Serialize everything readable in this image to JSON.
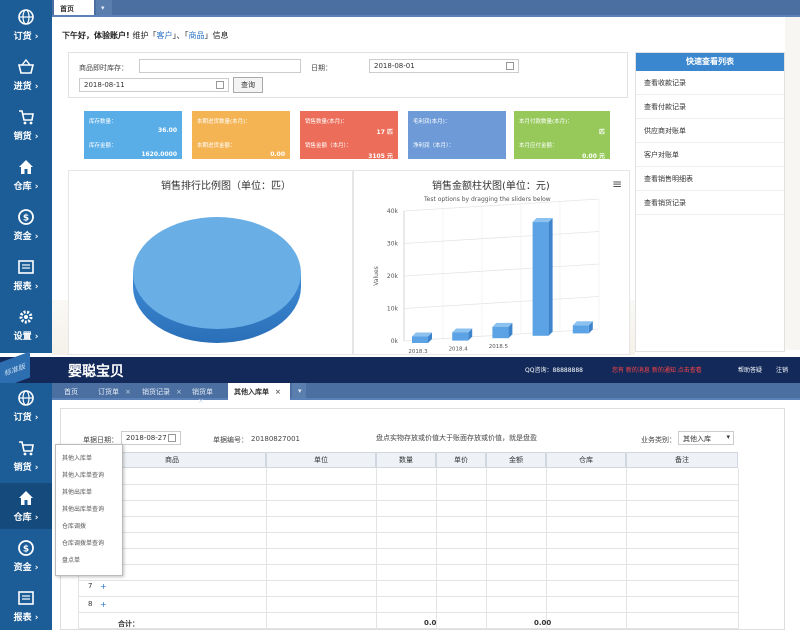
{
  "top": {
    "tabs": [
      {
        "label": "首页"
      }
    ],
    "greeting": {
      "text": "下午好，体验账户!",
      "prefix": "维护「",
      "link1": "客户",
      "sep": "」、「",
      "link2": "商品",
      "suffix": "」信息"
    },
    "filter": {
      "product_label": "商品即时库存：",
      "product_value": "",
      "date_label": "日期：",
      "date_value": "2018-08-01",
      "date2_value": "2018-08-11",
      "query_button": "查询"
    },
    "cards": [
      {
        "color": "#5aaee8",
        "lines": [
          {
            "label": "库存数量：",
            "value": "36.00"
          },
          {
            "label": "库存金额：",
            "value": "1620.0000"
          }
        ]
      },
      {
        "color": "#f4b454",
        "lines": [
          {
            "label": "本期进货数量(本月)：",
            "value": ""
          },
          {
            "label": "本期进货金额：",
            "value": "0.00"
          }
        ]
      },
      {
        "color": "#ec6e5a",
        "lines": [
          {
            "label": "销售数量(本月)：",
            "value": "17 匹"
          },
          {
            "label": "销售金额（本月）：",
            "value": "3105 元"
          }
        ]
      },
      {
        "color": "#6e9bd8",
        "lines": [
          {
            "label": "毛利润(本月)：",
            "value": ""
          },
          {
            "label": "净利润（本月）：",
            "value": ""
          }
        ]
      },
      {
        "color": "#96c95a",
        "lines": [
          {
            "label": "本月付款数量(本月)：",
            "value": "匹"
          },
          {
            "label": "本月应付金额：",
            "value": "0.00 元"
          }
        ]
      }
    ],
    "pie_title": "销售排行比例图（单位：匹）",
    "bar_title": "销售金额柱状图(单位：元)",
    "bar_subtitle": "Test options by dragging the sliders below",
    "menu_icon": "hamburger-icon",
    "quick_list": {
      "title": "快速查看列表",
      "items": [
        "查看收款记录",
        "查看付款记录",
        "供应商对账单",
        "客户对账单",
        "查看销售明细表",
        "查看销货记录"
      ]
    },
    "sidebar": [
      {
        "label": "订货",
        "icon": "globe-icon"
      },
      {
        "label": "进货",
        "icon": "basket-icon"
      },
      {
        "label": "销货",
        "icon": "cart-icon"
      },
      {
        "label": "仓库",
        "icon": "home-icon"
      },
      {
        "label": "资金",
        "icon": "coin-icon"
      },
      {
        "label": "报表",
        "icon": "report-icon"
      },
      {
        "label": "设置",
        "icon": "gear-icon"
      }
    ]
  },
  "chart_data": [
    {
      "type": "pie",
      "title": "销售排行比例图（单位：匹）",
      "slices": [
        {
          "label": "",
          "value": 100
        }
      ]
    },
    {
      "type": "bar",
      "title": "销售金额柱状图(单位：元)",
      "subtitle": "Test options by dragging the sliders below",
      "ylabel": "Values",
      "ylim": [
        0,
        40000
      ],
      "yticks": [
        "0k",
        "10k",
        "20k",
        "30k",
        "40k"
      ],
      "categories": [
        "2018.3",
        "2018.4",
        "2018.5",
        "",
        ""
      ],
      "values": [
        2000,
        2500,
        3500,
        35000,
        2500
      ]
    }
  ],
  "bottom": {
    "logo": "婴聪宝贝",
    "badge": "标准版",
    "header": {
      "qq": "QQ咨询：88888888",
      "red": "您有 新的消息 新的通知 点击查看",
      "help": "帮助答疑",
      "logout": "注销"
    },
    "tabs": [
      {
        "label": "首页"
      },
      {
        "label": "订货单"
      },
      {
        "label": "销货记录"
      },
      {
        "label": "销货单"
      },
      {
        "label": "其他入库单"
      }
    ],
    "form": {
      "date_label": "单据日期：",
      "date_value": "2018-08-27",
      "no_label": "单据编号：",
      "no_value": "20180827001",
      "note": "盘点实物存放或价值大于账面存放或价值，就是盘盈",
      "type_label": "业务类别：",
      "type_value": "其他入库"
    },
    "columns": [
      "商品",
      "单位",
      "数量",
      "单价",
      "金额",
      "仓库",
      "备注"
    ],
    "rows": [
      {
        "no": "7",
        "add": "+"
      },
      {
        "no": "8",
        "add": "+"
      }
    ],
    "total_label": "合计：",
    "total_qty": "0.0",
    "total_amount": "0.00",
    "dropdown": [
      "其他入库单",
      "其他入库单查询",
      "其他出库单",
      "其他出库单查询",
      "仓库调拨",
      "仓库调拨单查询",
      "盘点单"
    ],
    "sidebar": [
      {
        "label": "订货",
        "icon": "globe-icon"
      },
      {
        "label": "销货",
        "icon": "cart-icon"
      },
      {
        "label": "仓库",
        "icon": "home-icon"
      },
      {
        "label": "资金",
        "icon": "coin-icon"
      },
      {
        "label": "报表",
        "icon": "report-icon"
      }
    ]
  }
}
